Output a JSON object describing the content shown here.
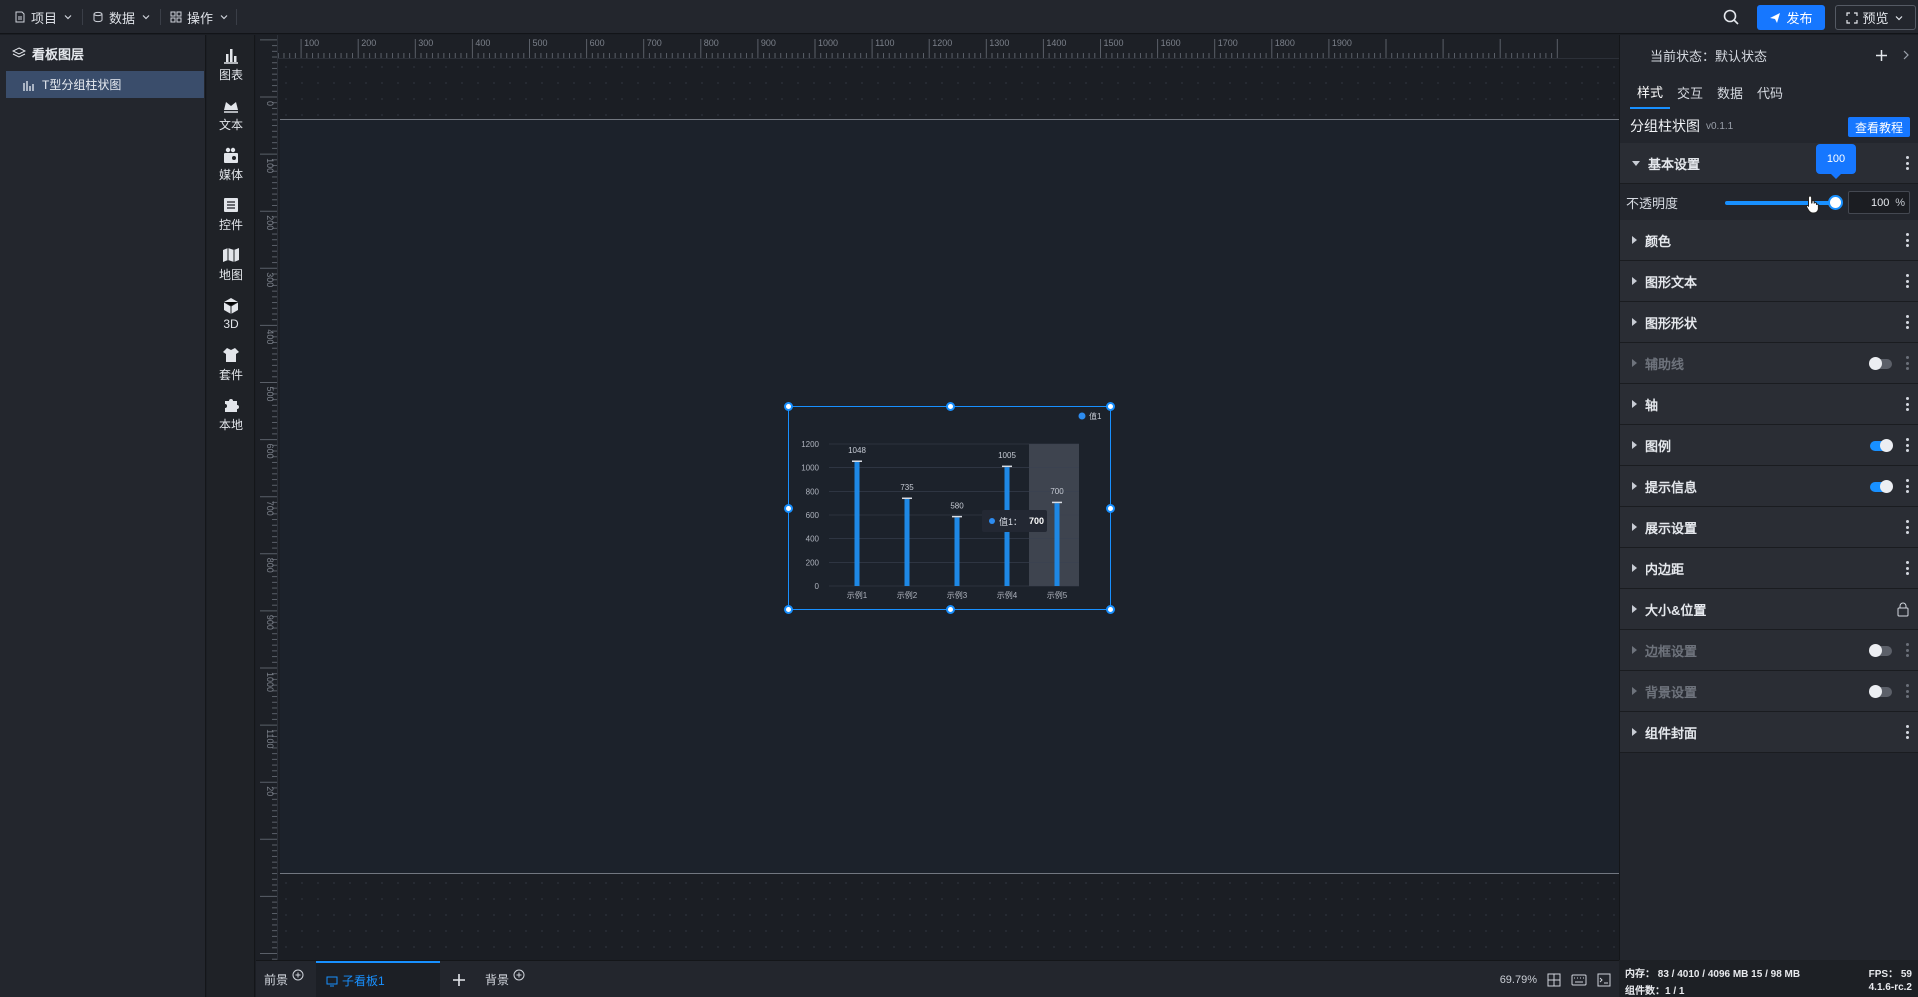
{
  "topbar": {
    "menus": [
      {
        "label": "项目",
        "icon": "file-icon"
      },
      {
        "label": "数据",
        "icon": "database-icon"
      },
      {
        "label": "操作",
        "icon": "grid-icon"
      }
    ],
    "publish_label": "发布",
    "preview_label": "预览"
  },
  "layers": {
    "title": "看板图层",
    "items": [
      {
        "label": "T型分组柱状图"
      }
    ]
  },
  "components": [
    {
      "label": "图表",
      "icon": "bar-chart-icon"
    },
    {
      "label": "文本",
      "icon": "text-icon"
    },
    {
      "label": "媒体",
      "icon": "media-icon"
    },
    {
      "label": "控件",
      "icon": "control-icon"
    },
    {
      "label": "地图",
      "icon": "map-icon"
    },
    {
      "label": "3D",
      "icon": "cube-icon"
    },
    {
      "label": "套件",
      "icon": "kit-icon"
    },
    {
      "label": "本地",
      "icon": "puzzle-icon"
    }
  ],
  "ruler": {
    "h_labels": [
      "100",
      "200",
      "300",
      "400",
      "500",
      "600",
      "700",
      "800",
      "900",
      "1000",
      "1100",
      "1200",
      "1300",
      "1400",
      "1500",
      "1600",
      "1700",
      "1800",
      "1900"
    ],
    "v_labels": [
      "0",
      "100",
      "200",
      "300",
      "400",
      "500",
      "600",
      "700",
      "800",
      "900",
      "1000",
      "1100",
      "20"
    ]
  },
  "chart_data": {
    "type": "bar",
    "categories": [
      "示例1",
      "示例2",
      "示例3",
      "示例4",
      "示例5"
    ],
    "series": [
      {
        "name": "值1",
        "values": [
          1048,
          735,
          580,
          1005,
          700
        ]
      }
    ],
    "ylim": [
      0,
      1200
    ],
    "yticks": [
      "0",
      "200",
      "400",
      "600",
      "800",
      "1000",
      "1200"
    ],
    "data_labels": [
      "1048",
      "735",
      "580",
      "1005",
      "700"
    ],
    "legend": "top-right",
    "grid": true,
    "highlight_index": 4,
    "bar_color": "#1e88e5",
    "tooltip": {
      "series": "值1：",
      "value": "700"
    }
  },
  "bottom_tabs": {
    "front": "前景",
    "sub": "子看板1",
    "back": "背景",
    "zoom": "69.79%"
  },
  "props": {
    "state_label": "当前状态：",
    "state_value": "默认状态",
    "tabs": [
      "样式",
      "交互",
      "数据",
      "代码"
    ],
    "comp_name": "分组柱状图",
    "comp_version": "v0.1.1",
    "tutorial_label": "查看教程",
    "basic": "基本设置",
    "opacity_label": "不透明度",
    "opacity_value": "100",
    "opacity_percent": 100,
    "opacity_unit": "%",
    "sections": [
      {
        "label": "颜色",
        "kind": "menu"
      },
      {
        "label": "图形文本",
        "kind": "menu"
      },
      {
        "label": "图形形状",
        "kind": "menu"
      },
      {
        "label": "辅助线",
        "kind": "toggle-off",
        "disabled": true
      },
      {
        "label": "轴",
        "kind": "menu"
      },
      {
        "label": "图例",
        "kind": "toggle-on"
      },
      {
        "label": "提示信息",
        "kind": "toggle-on"
      },
      {
        "label": "展示设置",
        "kind": "menu"
      },
      {
        "label": "内边距",
        "kind": "menu"
      },
      {
        "label": "大小&位置",
        "kind": "lock"
      },
      {
        "label": "边框设置",
        "kind": "toggle-off",
        "disabled": true
      },
      {
        "label": "背景设置",
        "kind": "toggle-off",
        "disabled": true
      },
      {
        "label": "组件封面",
        "kind": "menu"
      }
    ]
  },
  "status": {
    "memory": "内存：  83 / 4010 / 4096 MB   15 / 98 MB",
    "components": "组件数：1 / 1",
    "fps": "FPS：  59",
    "version": "4.1.6-rc.2"
  }
}
